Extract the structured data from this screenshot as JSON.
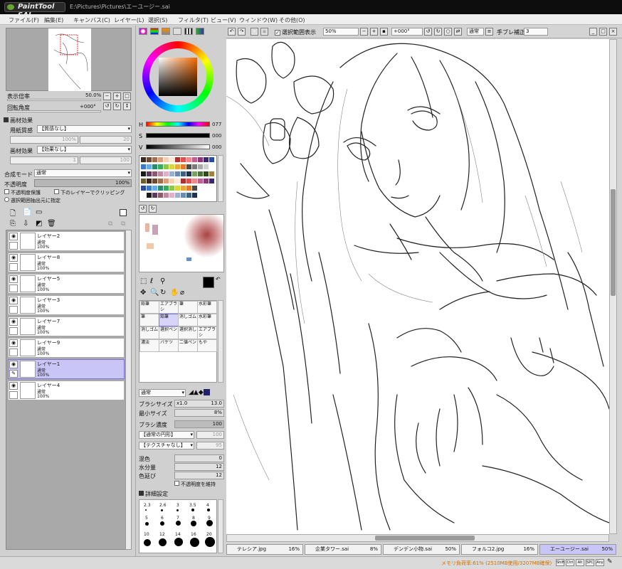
{
  "app": {
    "logo": "SAI",
    "window_title": "E:\\Pictures\\Pictures\\エーユージー.sai"
  },
  "menu": [
    "ファイル(F)",
    "編集(E)",
    "キャンバス(C)",
    "レイヤー(L)",
    "選択(S)",
    "フィルタ(T)",
    "ビュー(V)",
    "ウィンドウ(W)",
    "その他(O)"
  ],
  "nav": {
    "zoom_label": "表示倍率",
    "zoom_value": "50.0%",
    "rotate_label": "回転角度",
    "rotate_value": "+000°"
  },
  "effects": {
    "header": "画材効果",
    "paper_label": "用紙質感",
    "paper_value": "【質感なし】",
    "paper_scale": "100%",
    "paper_amt": "20",
    "effect_label": "画材効果",
    "effect_value": "【効果なし】",
    "effect_width": "1",
    "effect_amt": "100"
  },
  "blend": {
    "mode_label": "合成モード",
    "mode_value": "通常",
    "opacity_label": "不透明度",
    "opacity_value": "100%",
    "preserve_opacity": "不透明度保護",
    "clip": "下のレイヤーでクリッピング",
    "selection_source": "選択範囲抽出元に指定"
  },
  "layers": [
    {
      "name": "レイヤー2",
      "mode": "通常",
      "opacity": "100%",
      "selected": false
    },
    {
      "name": "レイヤー8",
      "mode": "通常",
      "opacity": "100%",
      "selected": false
    },
    {
      "name": "レイヤー5",
      "mode": "通常",
      "opacity": "100%",
      "selected": false
    },
    {
      "name": "レイヤー3",
      "mode": "通常",
      "opacity": "100%",
      "selected": false
    },
    {
      "name": "レイヤー7",
      "mode": "通常",
      "opacity": "100%",
      "selected": false
    },
    {
      "name": "レイヤー9",
      "mode": "通常",
      "opacity": "100%",
      "selected": false
    },
    {
      "name": "レイヤー1",
      "mode": "通常",
      "opacity": "100%",
      "selected": true
    },
    {
      "name": "レイヤー4",
      "mode": "通常",
      "opacity": "100%",
      "selected": false
    }
  ],
  "color": {
    "h_label": "H",
    "h_value": "077",
    "s_label": "S",
    "s_value": "000",
    "v_label": "V",
    "v_value": "000"
  },
  "tools": [
    {
      "name": "鉛筆",
      "selected": false
    },
    {
      "name": "エアブラシ",
      "selected": false
    },
    {
      "name": "筆",
      "selected": false
    },
    {
      "name": "水彩筆",
      "selected": false
    },
    {
      "name": "鉛筆",
      "selected": true
    },
    {
      "name": "消しゴム",
      "selected": false
    },
    {
      "name": "選択ペン",
      "selected": false
    },
    {
      "name": "選択消し",
      "selected": false
    },
    {
      "name": "バケツ",
      "selected": false
    },
    {
      "name": "二値ペン",
      "selected": false
    },
    {
      "name": "もや",
      "selected": false
    },
    {
      "name": "濃淡",
      "selected": false
    }
  ],
  "brush": {
    "mode": "通常",
    "size_label": "ブラシサイズ",
    "size_mult": "x1.0",
    "size_value": "13.0",
    "min_label": "最小サイズ",
    "min_value": "8%",
    "density_label": "ブラシ濃度",
    "density_value": "100",
    "shape": "【通常の円形】",
    "shape_amt": "100",
    "texture": "【テクスチャなし】",
    "texture_amt": "95",
    "blend_label": "混色",
    "blend_value": "0",
    "water_label": "水分量",
    "water_value": "12",
    "stretch_label": "色延び",
    "stretch_value": "12",
    "keep_opacity": "不透明度を維持",
    "detail": "詳細設定"
  },
  "brush_sizes": {
    "row1": [
      "2.3",
      "2.6",
      "3",
      "3.5",
      "4"
    ],
    "row2": [
      "5",
      "6",
      "7",
      "8",
      "9"
    ],
    "row3": [
      "10",
      "12",
      "14",
      "16",
      "20"
    ]
  },
  "toolbar": {
    "show_selection": "選択範囲表示",
    "zoom": "50%",
    "angle": "+000°",
    "blend": "通常",
    "stabilizer_label": "手ブレ補正",
    "stabilizer_value": "3"
  },
  "tabs": [
    {
      "name": "テレシア.jpg",
      "zoom": "16%",
      "selected": false
    },
    {
      "name": "企業タワー.sai",
      "zoom": "8%",
      "selected": false
    },
    {
      "name": "デンデン小物.sai",
      "zoom": "50%",
      "selected": false
    },
    {
      "name": "フォルコ2.jpg",
      "zoom": "16%",
      "selected": false
    },
    {
      "name": "エーユージー.sai",
      "zoom": "50%",
      "selected": true
    }
  ],
  "status": {
    "memory": "メモリ負荷率:61% (2510MB使用/3207MB確保)",
    "keys": [
      "Shift",
      "Ctrl",
      "Alt",
      "SPC",
      "Any"
    ]
  },
  "colors": {
    "accent": "#c9c6f7",
    "accent_border": "#7a74d6",
    "memory_text": "#d07000"
  }
}
